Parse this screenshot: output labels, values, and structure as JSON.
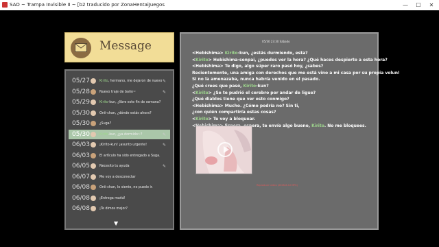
{
  "window": {
    "title": "SAO ~ Trampa Invisible II ~ [b2 traducido por ZonaHentaiJuegos",
    "controls": {
      "minimize": "—",
      "maximize": "☐",
      "close": "✕"
    }
  },
  "header": {
    "label": "Message"
  },
  "list": {
    "items": [
      {
        "date": "05/27",
        "name": "Kirito",
        "text": ", hermano, me dejaron de nuevo",
        "clip": true
      },
      {
        "date": "05/28",
        "name": "",
        "text": "Nuevo traje de baño~",
        "clip": true
      },
      {
        "date": "05/29",
        "name": "Kirito",
        "text": "-kun, ¿libre este fin de semana?",
        "clip": false
      },
      {
        "date": "05/30",
        "name": "",
        "text": "Onii-chan, ¿dónde estás ahora?",
        "clip": false
      },
      {
        "date": "05/30",
        "name": "",
        "text": "¿Suga?",
        "clip": false
      },
      {
        "date": "05/30",
        "name": "Kirito",
        "text": "-kun, ¿ya dormido~?",
        "clip": true,
        "selected": true
      },
      {
        "date": "06/03",
        "name": "",
        "text": "¡Kirito-kun! ¡asunto urgente!",
        "clip": true
      },
      {
        "date": "06/03",
        "name": "",
        "text": "El artículo ha sido entregado a Suga.",
        "clip": false
      },
      {
        "date": "06/05",
        "name": "",
        "text": "Necesito tu ayuda",
        "clip": true
      },
      {
        "date": "06/07",
        "name": "",
        "text": "Me voy a desconectar",
        "clip": false
      },
      {
        "date": "06/08",
        "name": "",
        "text": "Onii-chan, lo siento, no puedo ir.",
        "clip": false
      },
      {
        "date": "06/08",
        "name": "",
        "text": "¡Entrega mañá!",
        "clip": false
      },
      {
        "date": "06/08",
        "name": "",
        "text": "¡Te dimos mejor?",
        "clip": false
      }
    ],
    "more_arrow": "▼"
  },
  "message": {
    "timestamp": "05/30 23:30 Sábado",
    "lines": [
      {
        "pre": "<Hebishima> ",
        "hl": "Kirito",
        "post": "-kun, ¿estás durmiendo, esta?"
      },
      {
        "pre": "<",
        "hl": "Kirito",
        "post": "> Hebishima-senpai, ¿puedes ver la hora? ¿Qué haces despierto a esta hora?"
      },
      {
        "pre": "<Hebishima> Te digo, algo súper raro pasó hoy, ¿sabes?",
        "hl": "",
        "post": ""
      },
      {
        "pre": "Recientemente, una amiga con derechos que me está vino a mi casa por su propia volun!",
        "hl": "",
        "post": ""
      },
      {
        "pre": "Si no la amenazaba, nunca habría venido en el pasado.",
        "hl": "",
        "post": ""
      },
      {
        "pre": "¿Qué crees que pasó, ",
        "hl": "Kirito",
        "post": "-kun?"
      },
      {
        "pre": "<",
        "hl": "Kirito",
        "post": "> ¿Se te pudrió el cerebro por andar de ligue?"
      },
      {
        "pre": "¿Qué diablos tiene que ver esto conmigo?",
        "hl": "",
        "post": ""
      },
      {
        "pre": "<Hebishima> Mucho. ¿Cómo podría no? Sin ti,",
        "hl": "",
        "post": ""
      },
      {
        "pre": "¿con quién compartiría estas cosas?",
        "hl": "",
        "post": ""
      },
      {
        "pre": "<",
        "hl": "Kirito",
        "post": "> Te voy a bloquear."
      },
      {
        "pre": "<Hebishima> Espera, espera, te envío algo bueno, ",
        "hl": "Kirito",
        "post": ". No me bloquees."
      }
    ],
    "attachment_caption": "Reproducir video (2026-6-12 MP4)"
  }
}
